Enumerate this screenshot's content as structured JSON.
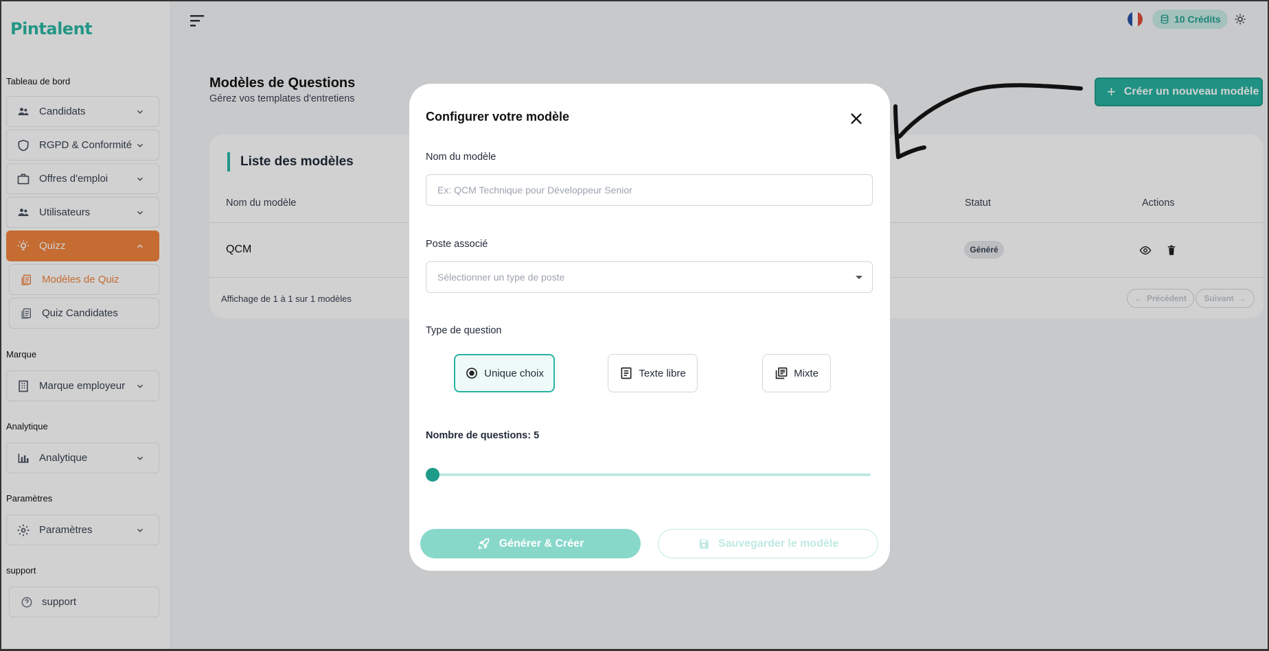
{
  "brand": {
    "logo_text": "Pintalent",
    "accent": "#2bb7a4",
    "orange": "#f1843f"
  },
  "sidebar": {
    "sections": {
      "dashboard": "Tableau de bord",
      "marque": "Marque",
      "analytique": "Analytique",
      "parametres": "Paramètres",
      "support": "support"
    },
    "items": {
      "candidats": "Candidats",
      "rgpd": "RGPD & Conformité",
      "offres": "Offres d'emploi",
      "utilisateurs": "Utilisateurs",
      "quizz": "Quizz",
      "modeles_quiz": "Modèles de Quiz",
      "quiz_candidates": "Quiz Candidates",
      "marque_employeur": "Marque employeur",
      "analytique": "Analytique",
      "parametres": "Paramètres",
      "support": "support"
    }
  },
  "header": {
    "credits": "10 Crédits",
    "language": "fr"
  },
  "page": {
    "title": "Modèles de Questions",
    "subtitle": "Gérez vos templates d'entretiens",
    "new_button": "Créer un nouveau modèle"
  },
  "list": {
    "title": "Liste des modèles",
    "columns": {
      "name": "Nom du modèle",
      "status": "Statut",
      "actions": "Actions"
    },
    "rows": [
      {
        "name": "QCM",
        "status": "Généré"
      }
    ],
    "pagination": {
      "info": "Affichage de 1 à 1 sur 1 modèles",
      "prev": "Précédent",
      "next": "Suivant"
    }
  },
  "modal": {
    "title": "Configurer votre modèle",
    "name_label": "Nom du modèle",
    "name_placeholder": "Ex: QCM Technique pour Développeur Senior",
    "poste_label": "Poste associé",
    "poste_placeholder": "Sélectionner un type de poste",
    "type_label": "Type de question",
    "types": [
      {
        "label": "Unique choix",
        "selected": true
      },
      {
        "label": "Texte libre",
        "selected": false
      },
      {
        "label": "Mixte",
        "selected": false
      }
    ],
    "count_label": "Nombre de questions: 5",
    "count_value": 5,
    "generate_button": "Générer & Créer",
    "save_button": "Sauvegarder le modèle"
  }
}
